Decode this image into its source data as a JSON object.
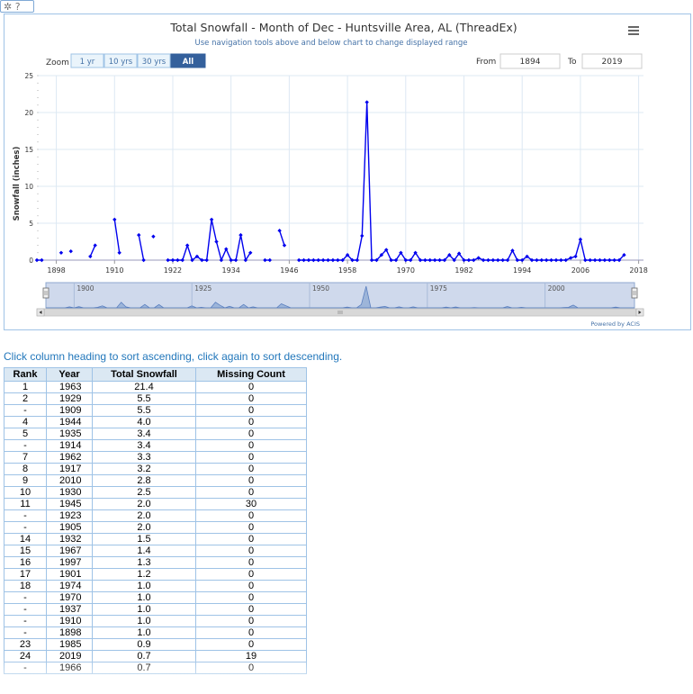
{
  "toolbar": {
    "gear_icon": "gear-icon",
    "help_label": "?"
  },
  "chart_ui": {
    "zoom_label": "Zoom",
    "zoom_buttons": [
      "1 yr",
      "10 yrs",
      "30 yrs",
      "All"
    ],
    "zoom_selected": "All",
    "from_label": "From",
    "from_value": "1894",
    "to_label": "To",
    "to_value": "2019",
    "menu_icon": "hamburger-menu-icon",
    "credit": "Powered by ACIS",
    "navigator_labels": [
      "1900",
      "1925",
      "1950",
      "1975",
      "2000"
    ]
  },
  "chart_data": {
    "type": "line",
    "title": "Total Snowfall - Month of Dec - Huntsville Area, AL (ThreadEx)",
    "subtitle": "Use navigation tools above and below chart to change displayed range",
    "xlabel": "",
    "ylabel": "Snowfall (inches)",
    "xlim": [
      1894,
      2019
    ],
    "ylim": [
      0,
      25
    ],
    "xticks": [
      1898,
      1910,
      1922,
      1934,
      1946,
      1958,
      1970,
      1982,
      1994,
      2006,
      2018
    ],
    "yticks": [
      0,
      5,
      10,
      15,
      20,
      25
    ],
    "grid": true,
    "legend": "none",
    "color": "#0000ee",
    "x": [
      1894,
      1895,
      1897,
      1898,
      1899,
      1900,
      1901,
      1902,
      1903,
      1904,
      1905,
      1906,
      1907,
      1908,
      1909,
      1910,
      1911,
      1912,
      1913,
      1914,
      1915,
      1916,
      1917,
      1918,
      1919,
      1920,
      1921,
      1922,
      1923,
      1924,
      1925,
      1926,
      1927,
      1928,
      1929,
      1930,
      1931,
      1932,
      1933,
      1934,
      1935,
      1936,
      1937,
      1938,
      1939,
      1940,
      1941,
      1942,
      1943,
      1944,
      1945,
      1946,
      1947,
      1948,
      1949,
      1950,
      1951,
      1952,
      1953,
      1954,
      1955,
      1956,
      1957,
      1958,
      1959,
      1960,
      1961,
      1962,
      1963,
      1964,
      1965,
      1966,
      1967,
      1968,
      1969,
      1970,
      1971,
      1972,
      1973,
      1974,
      1975,
      1976,
      1977,
      1978,
      1979,
      1980,
      1981,
      1982,
      1983,
      1984,
      1985,
      1986,
      1987,
      1988,
      1989,
      1990,
      1991,
      1992,
      1993,
      1994,
      1995,
      1996,
      1997,
      1998,
      1999,
      2000,
      2001,
      2002,
      2003,
      2004,
      2005,
      2006,
      2007,
      2008,
      2009,
      2010,
      2011,
      2012,
      2013,
      2014,
      2015,
      2016,
      2017,
      2018,
      2019
    ],
    "values": [
      0,
      0,
      null,
      null,
      1.0,
      null,
      1.2,
      null,
      null,
      null,
      0.5,
      2.0,
      null,
      null,
      null,
      5.5,
      1.0,
      null,
      null,
      null,
      3.4,
      0,
      null,
      3.2,
      null,
      null,
      0,
      0,
      0,
      0,
      2.0,
      0,
      0.5,
      0,
      0,
      5.5,
      2.5,
      0,
      1.5,
      0,
      0,
      3.4,
      0,
      1.0,
      null,
      null,
      0,
      0,
      null,
      4.0,
      2.0,
      null,
      null,
      0,
      0,
      0,
      0,
      0,
      0,
      0,
      0,
      0,
      0,
      0.7,
      0,
      0,
      3.3,
      21.4,
      0,
      0,
      0.7,
      1.4,
      0,
      0,
      1.0,
      0,
      0,
      1.0,
      0,
      0,
      0,
      0,
      0,
      0,
      0.7,
      0,
      0.9,
      0,
      0,
      0,
      0.3,
      0,
      0,
      0,
      0,
      0,
      0,
      1.3,
      0,
      0,
      0.5,
      0,
      0,
      0,
      0,
      0,
      0,
      0,
      0,
      0.3,
      0.5,
      2.8,
      0,
      0,
      0,
      0,
      0,
      0,
      0,
      0,
      0.7,
      null
    ]
  },
  "table": {
    "note": "Click column heading to sort ascending, click again to sort descending.",
    "headers": [
      "Rank",
      "Year",
      "Total Snowfall",
      "Missing Count"
    ],
    "rows": [
      [
        "1",
        "1963",
        "21.4",
        "0"
      ],
      [
        "2",
        "1929",
        "5.5",
        "0"
      ],
      [
        "-",
        "1909",
        "5.5",
        "0"
      ],
      [
        "4",
        "1944",
        "4.0",
        "0"
      ],
      [
        "5",
        "1935",
        "3.4",
        "0"
      ],
      [
        "-",
        "1914",
        "3.4",
        "0"
      ],
      [
        "7",
        "1962",
        "3.3",
        "0"
      ],
      [
        "8",
        "1917",
        "3.2",
        "0"
      ],
      [
        "9",
        "2010",
        "2.8",
        "0"
      ],
      [
        "10",
        "1930",
        "2.5",
        "0"
      ],
      [
        "11",
        "1945",
        "2.0",
        "30"
      ],
      [
        "-",
        "1923",
        "2.0",
        "0"
      ],
      [
        "-",
        "1905",
        "2.0",
        "0"
      ],
      [
        "14",
        "1932",
        "1.5",
        "0"
      ],
      [
        "15",
        "1967",
        "1.4",
        "0"
      ],
      [
        "16",
        "1997",
        "1.3",
        "0"
      ],
      [
        "17",
        "1901",
        "1.2",
        "0"
      ],
      [
        "18",
        "1974",
        "1.0",
        "0"
      ],
      [
        "-",
        "1970",
        "1.0",
        "0"
      ],
      [
        "-",
        "1937",
        "1.0",
        "0"
      ],
      [
        "-",
        "1910",
        "1.0",
        "0"
      ],
      [
        "-",
        "1898",
        "1.0",
        "0"
      ],
      [
        "23",
        "1985",
        "0.9",
        "0"
      ],
      [
        "24",
        "2019",
        "0.7",
        "19"
      ],
      [
        "-",
        "1966",
        "0.7",
        "0"
      ]
    ]
  }
}
